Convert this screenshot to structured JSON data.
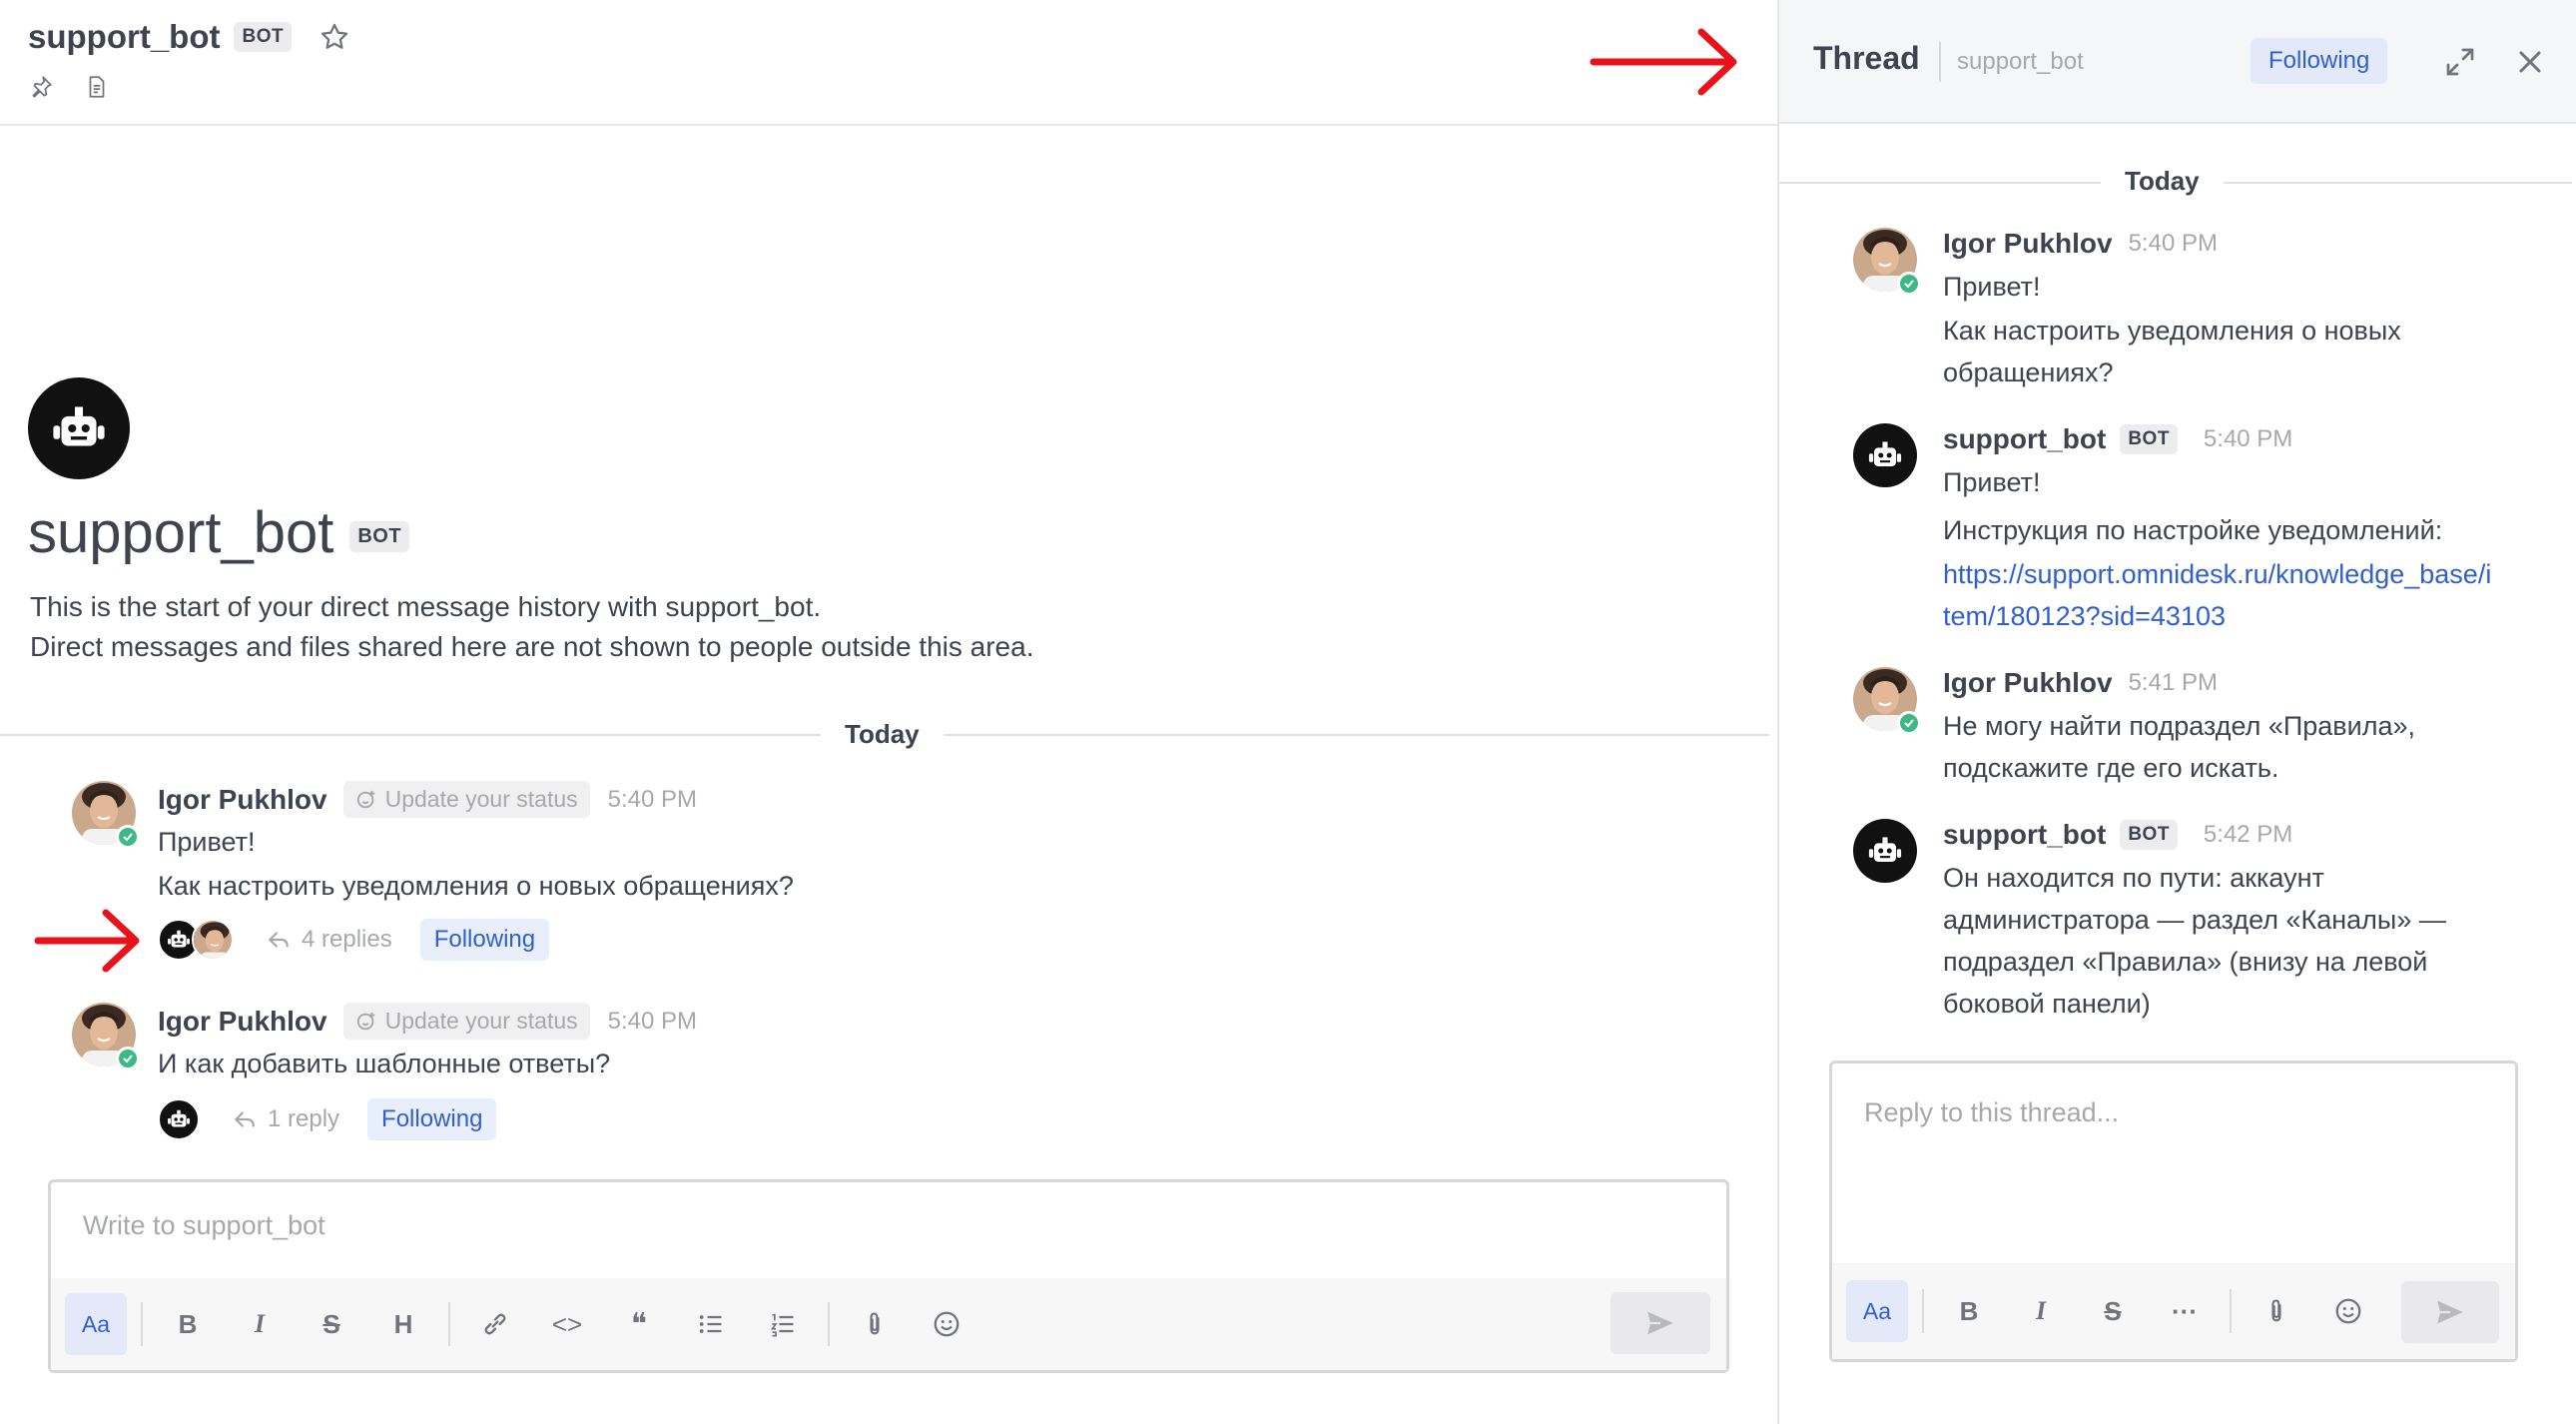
{
  "main": {
    "header": {
      "channel_name": "support_bot",
      "bot_tag": "BOT"
    },
    "intro": {
      "title": "support_bot",
      "bot_tag": "BOT",
      "line1": "This is the start of your direct message history with support_bot.",
      "line2": "Direct messages and files shared here are not shown to people outside this area."
    },
    "divider_label": "Today",
    "posts": [
      {
        "author": "Igor Pukhlov",
        "status_chip": "Update your status",
        "time": "5:40 PM",
        "lines": [
          "Привет!",
          "Как настроить уведомления о новых обращениях?"
        ],
        "replies": "4 replies",
        "following": "Following"
      },
      {
        "author": "Igor Pukhlov",
        "status_chip": "Update your status",
        "time": "5:40 PM",
        "lines": [
          "И как добавить шаблонные ответы?"
        ],
        "replies": "1 reply",
        "following": "Following"
      }
    ],
    "composer": {
      "placeholder": "Write to support_bot",
      "format_label": "Aa",
      "bold": "B",
      "italic": "I",
      "strike": "S",
      "heading": "H",
      "code": "<>",
      "quote": "❝"
    }
  },
  "thread": {
    "title": "Thread",
    "subtitle": "support_bot",
    "following": "Following",
    "divider_label": "Today",
    "messages": [
      {
        "author": "Igor Pukhlov",
        "time": "5:40 PM",
        "lines": [
          "Привет!",
          "Как настроить уведомления о новых",
          "обращениях?"
        ]
      },
      {
        "author": "support_bot",
        "bot_tag": "BOT",
        "time": "5:40 PM",
        "lines": [
          "Привет!",
          "Инструкция по настройке уведомлений:"
        ],
        "link_lines": [
          "https://support.omnidesk.ru/knowledge_base/i",
          "tem/180123?sid=43103"
        ]
      },
      {
        "author": "Igor Pukhlov",
        "time": "5:41 PM",
        "lines": [
          "Не могу найти подраздел «Правила»,",
          "подскажите где его искать."
        ]
      },
      {
        "author": "support_bot",
        "bot_tag": "BOT",
        "time": "5:42 PM",
        "lines": [
          "Он находится по пути: аккаунт",
          "администратора — раздел «Каналы» —",
          "подраздел «Правила» (внизу на левой",
          "боковой панели)"
        ]
      }
    ],
    "composer": {
      "placeholder": "Reply to this thread...",
      "format_label": "Aa",
      "bold": "B",
      "italic": "I",
      "strike": "S",
      "more": "···"
    }
  },
  "colors": {
    "accent": "#2f5fd1",
    "following_bg": "#e8eefc",
    "online": "#3db887",
    "annotation_arrow": "#e8121a"
  }
}
